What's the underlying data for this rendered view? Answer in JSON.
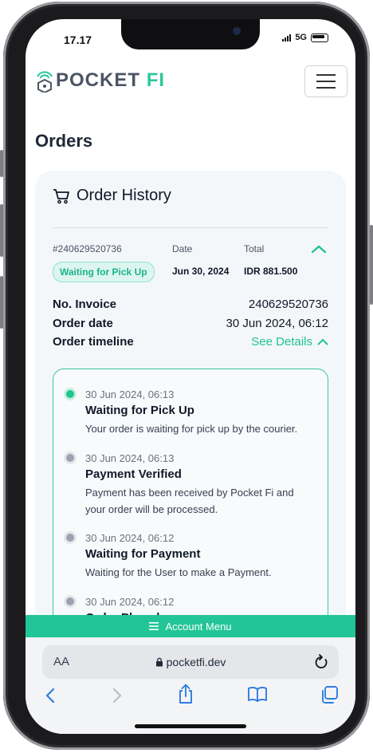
{
  "status_bar": {
    "time": "17.17",
    "network": "5G"
  },
  "header": {
    "logo_main": "POCKET",
    "logo_accent": "FI",
    "menu_icon": "hamburger-icon"
  },
  "page": {
    "title": "Orders"
  },
  "card": {
    "title": "Order History",
    "icon": "cart-icon",
    "order_id": "#240629520736",
    "date_label": "Date",
    "total_label": "Total",
    "status_badge": "Waiting for Pick Up",
    "date_value": "Jun 30, 2024",
    "total_value": "IDR 881.500"
  },
  "details": {
    "invoice_label": "No. Invoice",
    "invoice_value": "240629520736",
    "order_date_label": "Order date",
    "order_date_value": "30 Jun 2024, 06:12",
    "timeline_label": "Order timeline",
    "see_details": "See Details"
  },
  "timeline": [
    {
      "time": "30 Jun 2024, 06:13",
      "title": "Waiting for Pick Up",
      "desc": "Your order is waiting for pick up by the courier.",
      "active": true
    },
    {
      "time": "30 Jun 2024, 06:13",
      "title": "Payment Verified",
      "desc": "Payment has been received by Pocket Fi and your order will be processed.",
      "active": false
    },
    {
      "time": "30 Jun 2024, 06:12",
      "title": "Waiting for Payment",
      "desc": "Waiting for the User to make a Payment.",
      "active": false
    },
    {
      "time": "30 Jun 2024, 06:12",
      "title": "Order Placed",
      "desc": "",
      "active": false
    }
  ],
  "account_menu": {
    "label": "Account Menu"
  },
  "browser": {
    "aa": "AA",
    "url": "pocketfi.dev"
  },
  "colors": {
    "accent": "#22c597",
    "badge_bg": "#dcf5ee",
    "text": "#111827"
  }
}
